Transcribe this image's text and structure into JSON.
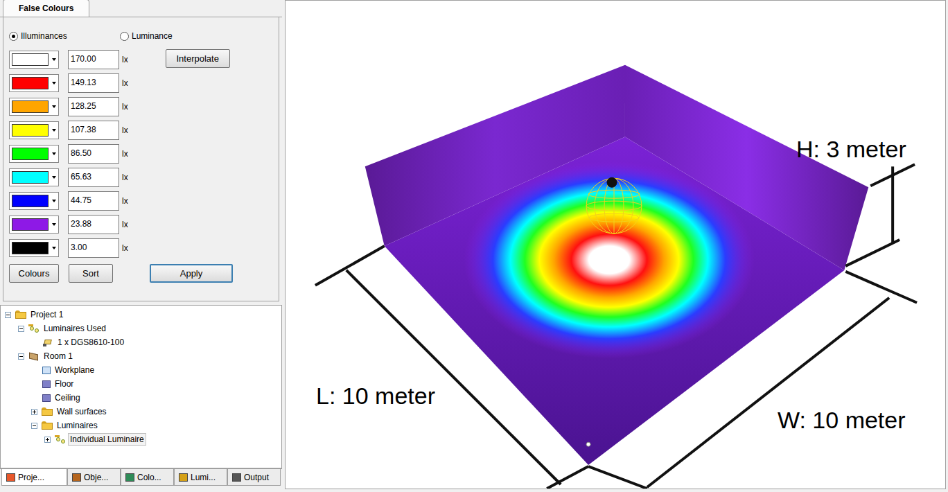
{
  "panel_tab": {
    "label": "False Colours"
  },
  "modes": [
    {
      "label": "Illuminances",
      "selected": true
    },
    {
      "label": "Luminance",
      "selected": false
    }
  ],
  "scale": [
    {
      "color": "#ffffff",
      "value": "170.00",
      "unit": "lx"
    },
    {
      "color": "#ff0000",
      "value": "149.13",
      "unit": "lx"
    },
    {
      "color": "#ffa500",
      "value": "128.25",
      "unit": "lx"
    },
    {
      "color": "#ffff00",
      "value": "107.38",
      "unit": "lx"
    },
    {
      "color": "#00ff00",
      "value": "86.50",
      "unit": "lx"
    },
    {
      "color": "#00ffff",
      "value": "65.63",
      "unit": "lx"
    },
    {
      "color": "#0000ff",
      "value": "44.75",
      "unit": "lx"
    },
    {
      "color": "#8e19e6",
      "value": "23.88",
      "unit": "lx"
    },
    {
      "color": "#000000",
      "value": "3.00",
      "unit": "lx"
    }
  ],
  "interpolate_button": "Interpolate",
  "bottom_buttons": [
    {
      "label": "Colours",
      "focused": false
    },
    {
      "label": "Sort",
      "focused": false
    },
    {
      "label": "Apply",
      "focused": true
    }
  ],
  "tree": [
    {
      "label": "Project 1",
      "depth": 0,
      "kind": "folder",
      "expandable": true,
      "expanded": true,
      "selected": false
    },
    {
      "label": "Luminaires Used",
      "depth": 1,
      "kind": "group",
      "expandable": true,
      "expanded": true,
      "selected": false
    },
    {
      "label": "1 x DGS8610-100",
      "depth": 2,
      "kind": "luminaire",
      "expandable": false,
      "expanded": false,
      "selected": false
    },
    {
      "label": "Room 1",
      "depth": 1,
      "kind": "room",
      "expandable": true,
      "expanded": true,
      "selected": false
    },
    {
      "label": "Workplane",
      "depth": 2,
      "kind": "workplane",
      "expandable": false,
      "expanded": false,
      "selected": false
    },
    {
      "label": "Floor",
      "depth": 2,
      "kind": "surface",
      "expandable": false,
      "expanded": false,
      "selected": false
    },
    {
      "label": "Ceiling",
      "depth": 2,
      "kind": "surface",
      "expandable": false,
      "expanded": false,
      "selected": false
    },
    {
      "label": "Wall surfaces",
      "depth": 2,
      "kind": "folder",
      "expandable": true,
      "expanded": false,
      "selected": false
    },
    {
      "label": "Luminaires",
      "depth": 2,
      "kind": "folder",
      "expandable": true,
      "expanded": true,
      "selected": false
    },
    {
      "label": "Individual Luminaire",
      "depth": 3,
      "kind": "group",
      "expandable": true,
      "expanded": false,
      "selected": true
    }
  ],
  "bottom_tabs": [
    {
      "label": "Proje...",
      "selected": true,
      "color": "#e8572a"
    },
    {
      "label": "Obje...",
      "selected": false,
      "color": "#b5651d"
    },
    {
      "label": "Colo...",
      "selected": false,
      "color": "#2e8b57"
    },
    {
      "label": "Lumi...",
      "selected": false,
      "color": "#d4a017"
    },
    {
      "label": "Output",
      "selected": false,
      "color": "#555555"
    }
  ],
  "viewport": {
    "height_label": "H: 3 meter",
    "length_label": "L: 10 meter",
    "width_label": "W: 10 meter"
  }
}
